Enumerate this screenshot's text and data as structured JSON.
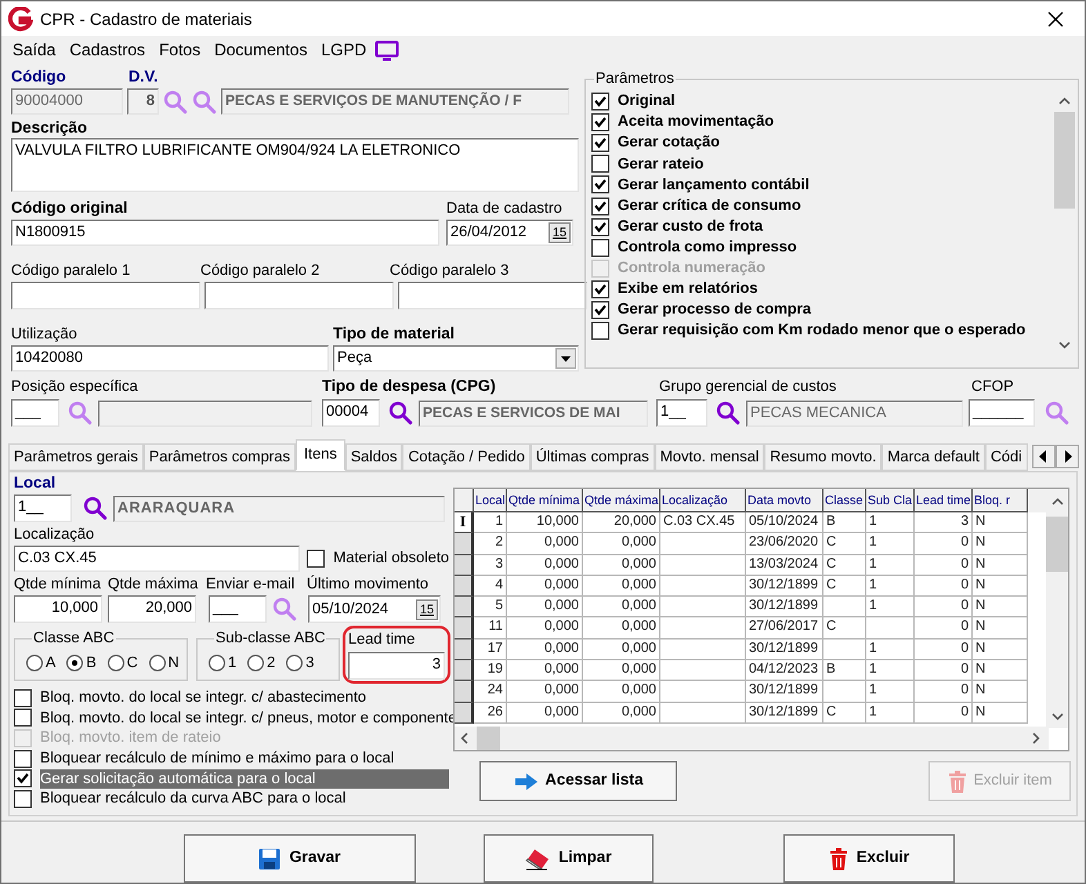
{
  "window": {
    "title": "CPR - Cadastro de materiais"
  },
  "menu": [
    "Saída",
    "Cadastros",
    "Fotos",
    "Documentos",
    "LGPD"
  ],
  "header": {
    "codigo": {
      "label": "Código",
      "value": "90004000"
    },
    "dv": {
      "label": "D.V.",
      "value": "8"
    },
    "grupo": "PECAS E SERVIÇOS DE MANUTENÇÃO / F",
    "descricao": {
      "label": "Descrição",
      "value": "VALVULA FILTRO LUBRIFICANTE OM904/924 LA ELETRONICO"
    },
    "codigo_original": {
      "label": "Código original",
      "value": "N1800915"
    },
    "data_cadastro": {
      "label": "Data de cadastro",
      "value": "26/04/2012",
      "button": "15"
    },
    "paralelos": [
      {
        "label": "Código paralelo 1"
      },
      {
        "label": "Código paralelo 2"
      },
      {
        "label": "Código paralelo 3"
      }
    ],
    "utilizacao": {
      "label": "Utilização",
      "value": "10420080"
    },
    "tipo_material": {
      "label": "Tipo de material",
      "value": "Peça"
    },
    "posicao": {
      "label": "Posição específica",
      "value": "___"
    },
    "tipo_despesa": {
      "label": "Tipo de despesa (CPG)",
      "code": "00004",
      "name": "PECAS E SERVICOS DE MAI"
    },
    "grupo_gerencial": {
      "label": "Grupo gerencial de custos",
      "code": "1__",
      "name": "PECAS MECANICA"
    },
    "cfop": {
      "label": "CFOP",
      "value": "______"
    }
  },
  "parametros": {
    "title": "Parâmetros",
    "items": [
      {
        "label": "Original",
        "checked": true,
        "disabled": false
      },
      {
        "label": "Aceita movimentação",
        "checked": true,
        "disabled": false
      },
      {
        "label": "Gerar cotação",
        "checked": true,
        "disabled": false
      },
      {
        "label": "Gerar rateio",
        "checked": false,
        "disabled": false
      },
      {
        "label": "Gerar lançamento contábil",
        "checked": true,
        "disabled": false
      },
      {
        "label": "Gerar crítica de consumo",
        "checked": true,
        "disabled": false
      },
      {
        "label": "Gerar custo de frota",
        "checked": true,
        "disabled": false
      },
      {
        "label": "Controla como impresso",
        "checked": false,
        "disabled": false
      },
      {
        "label": "Controla numeração",
        "checked": false,
        "disabled": true
      },
      {
        "label": "Exibe em relatórios",
        "checked": true,
        "disabled": false
      },
      {
        "label": "Gerar processo de compra",
        "checked": true,
        "disabled": false
      },
      {
        "label": "Gerar requisição com Km rodado menor que o esperado",
        "checked": false,
        "disabled": false
      }
    ]
  },
  "tabs": [
    {
      "label": "Parâmetros gerais",
      "selected": false
    },
    {
      "label": "Parâmetros compras",
      "selected": false
    },
    {
      "label": "Itens",
      "selected": true
    },
    {
      "label": "Saldos",
      "selected": false
    },
    {
      "label": "Cotação / Pedido",
      "selected": false
    },
    {
      "label": "Últimas compras",
      "selected": false
    },
    {
      "label": "Movto. mensal",
      "selected": false
    },
    {
      "label": "Resumo movto.",
      "selected": false
    },
    {
      "label": "Marca default",
      "selected": false
    },
    {
      "label": "Códi",
      "selected": false
    }
  ],
  "itens": {
    "local": {
      "label": "Local",
      "code": "1__",
      "name": "ARARAQUARA"
    },
    "localizacao": {
      "label": "Localização",
      "value": "C.03   CX.45"
    },
    "obsoleto": {
      "label": "Material obsoleto",
      "checked": false
    },
    "qtde_minima": {
      "label": "Qtde mínima",
      "value": "10,000"
    },
    "qtde_maxima": {
      "label": "Qtde máxima",
      "value": "20,000"
    },
    "enviar_email": {
      "label": "Enviar e-mail",
      "value": "___"
    },
    "ultimo_movimento": {
      "label": "Último movimento",
      "value": "05/10/2024",
      "button": "15"
    },
    "classe_abc": {
      "title": "Classe ABC",
      "options": [
        {
          "label": "A",
          "selected": false
        },
        {
          "label": "B",
          "selected": true
        },
        {
          "label": "C",
          "selected": false
        },
        {
          "label": "N",
          "selected": false
        }
      ]
    },
    "sub_classe_abc": {
      "title": "Sub-classe ABC",
      "options": [
        {
          "label": "1",
          "selected": false
        },
        {
          "label": "2",
          "selected": false
        },
        {
          "label": "3",
          "selected": false
        }
      ]
    },
    "lead_time": {
      "label": "Lead time",
      "value": "3"
    },
    "options": [
      {
        "label": "Bloq. movto. do local se integr. c/ abastecimento",
        "checked": false,
        "disabled": false,
        "selected": false
      },
      {
        "label": "Bloq. movto. do local se integr. c/ pneus, motor e componente",
        "checked": false,
        "disabled": false,
        "selected": false
      },
      {
        "label": "Bloq. movto. item de rateio",
        "checked": false,
        "disabled": true,
        "selected": false
      },
      {
        "label": "Bloquear recálculo de mínimo e máximo para o local",
        "checked": false,
        "disabled": false,
        "selected": false
      },
      {
        "label": "Gerar solicitação automática para o local",
        "checked": true,
        "disabled": false,
        "selected": true
      },
      {
        "label": "Bloquear recálculo da curva ABC para o local",
        "checked": false,
        "disabled": false,
        "selected": false
      }
    ]
  },
  "grid": {
    "columns": [
      "Local",
      "Qtde mínima",
      "Qtde máxima",
      "Localização",
      "Data movto",
      "Classe",
      "Sub Cla",
      "Lead time",
      "Bloq. r"
    ],
    "rows": [
      {
        "selected": true,
        "indicator": "I",
        "cells": [
          "1",
          "10,000",
          "20,000",
          "C.03   CX.45",
          "05/10/2024",
          "B",
          "1",
          "3",
          "N"
        ]
      },
      {
        "selected": false,
        "cells": [
          "2",
          "0,000",
          "0,000",
          "",
          "23/06/2020",
          "C",
          "1",
          "0",
          "N"
        ]
      },
      {
        "selected": false,
        "cells": [
          "3",
          "0,000",
          "0,000",
          "",
          "13/03/2024",
          "C",
          "1",
          "0",
          "N"
        ]
      },
      {
        "selected": false,
        "cells": [
          "4",
          "0,000",
          "0,000",
          "",
          "30/12/1899",
          "C",
          "1",
          "0",
          "N"
        ]
      },
      {
        "selected": false,
        "cells": [
          "5",
          "0,000",
          "0,000",
          "",
          "30/12/1899",
          "",
          "1",
          "0",
          "N"
        ]
      },
      {
        "selected": false,
        "cells": [
          "11",
          "0,000",
          "0,000",
          "",
          "27/06/2017",
          "C",
          "",
          "0",
          "N"
        ]
      },
      {
        "selected": false,
        "cells": [
          "17",
          "0,000",
          "0,000",
          "",
          "30/12/1899",
          "",
          "1",
          "0",
          "N"
        ]
      },
      {
        "selected": false,
        "cells": [
          "19",
          "0,000",
          "0,000",
          "",
          "04/12/2023",
          "B",
          "1",
          "0",
          "N"
        ]
      },
      {
        "selected": false,
        "cells": [
          "24",
          "0,000",
          "0,000",
          "",
          "30/12/1899",
          "",
          "1",
          "0",
          "N"
        ]
      },
      {
        "selected": false,
        "cells": [
          "26",
          "0,000",
          "0,000",
          "",
          "30/12/1899",
          "C",
          "1",
          "0",
          "N"
        ]
      }
    ]
  },
  "panel_buttons": [
    {
      "kind": "list",
      "label": "Acessar lista",
      "disabled": false
    },
    {
      "kind": "delete",
      "label": "Excluir item",
      "disabled": true
    }
  ],
  "buttons": [
    {
      "kind": "save",
      "label": "Gravar"
    },
    {
      "kind": "clear",
      "label": "Limpar"
    },
    {
      "kind": "delete",
      "label": "Excluir"
    }
  ]
}
